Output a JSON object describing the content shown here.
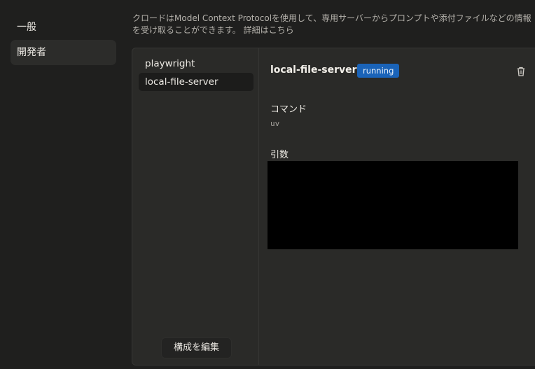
{
  "nav": {
    "items": [
      {
        "label": "一般",
        "active": false
      },
      {
        "label": "開発者",
        "active": true
      }
    ]
  },
  "description": {
    "line1": "クロードはModel Context Protocolを使用して、専用サーバーからプロンプトや添付ファイルなどの情報",
    "line2": "を受け取ることができます。",
    "link": "詳細はこちら"
  },
  "servers": {
    "items": [
      {
        "label": "playwright",
        "selected": false
      },
      {
        "label": "local-file-server",
        "selected": true
      }
    ],
    "edit_button": "構成を編集"
  },
  "detail": {
    "title": "local-file-server",
    "status": "running",
    "status_color": "#1a63b8",
    "delete_icon": "trash-icon",
    "command_label": "コマンド",
    "command_value": "uv",
    "args_label": "引数"
  }
}
